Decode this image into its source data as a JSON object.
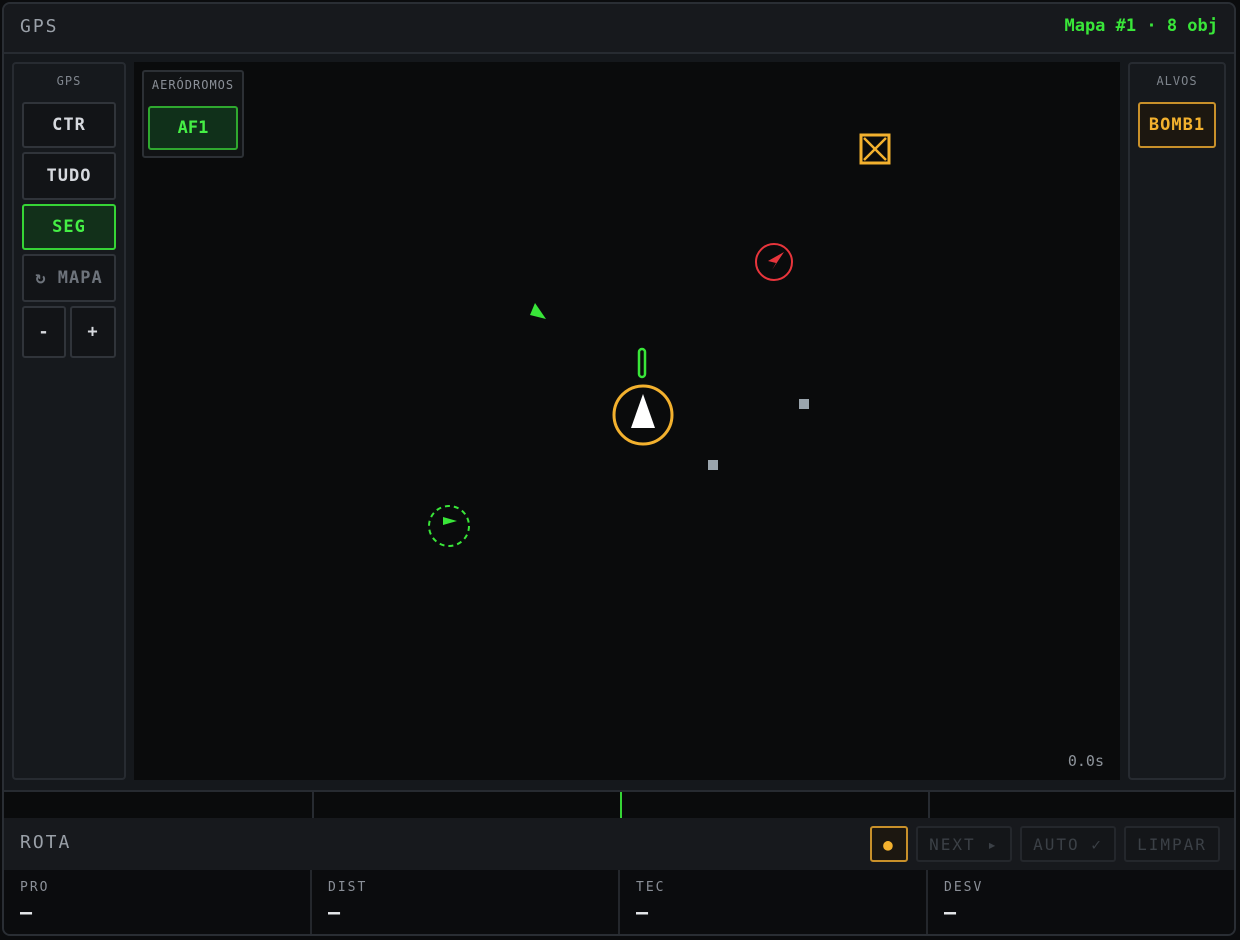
{
  "header": {
    "title": "GPS",
    "status": "Mapa #1 · 8 obj"
  },
  "left_panel": {
    "heading": "GPS",
    "buttons": [
      {
        "label": "CTR",
        "state": "normal"
      },
      {
        "label": "TUDO",
        "state": "normal"
      },
      {
        "label": "SEG",
        "state": "active"
      },
      {
        "label": "↻ MAPA",
        "state": "dim"
      }
    ],
    "zoom_out_label": "-",
    "zoom_in_label": "+"
  },
  "airfields": {
    "heading": "AERÓDROMOS",
    "items": [
      "AF1"
    ]
  },
  "right_panel": {
    "heading": "ALVOS",
    "items": [
      "BOMB1"
    ]
  },
  "map": {
    "elapsed": "0.0s"
  },
  "route": {
    "label": "ROTA",
    "dot_button": "●",
    "next_label": "NEXT ▸",
    "auto_label": "AUTO ✓",
    "clear_label": "LIMPAR"
  },
  "fields": [
    {
      "key": "PRO",
      "value": "—"
    },
    {
      "key": "DIST",
      "value": "—"
    },
    {
      "key": "TEC",
      "value": "—"
    },
    {
      "key": "DESV",
      "value": "—"
    }
  ],
  "colors": {
    "accent": "#39e639",
    "target": "#f3b12e",
    "enemy": "#e8353c",
    "neutral": "#9aa5ad"
  },
  "icons": [
    "target-marker-icon",
    "enemy-aircraft-icon",
    "friendly-arrow-icon",
    "own-aircraft-icon",
    "waypoint-icon",
    "friendly-unit-icon"
  ]
}
